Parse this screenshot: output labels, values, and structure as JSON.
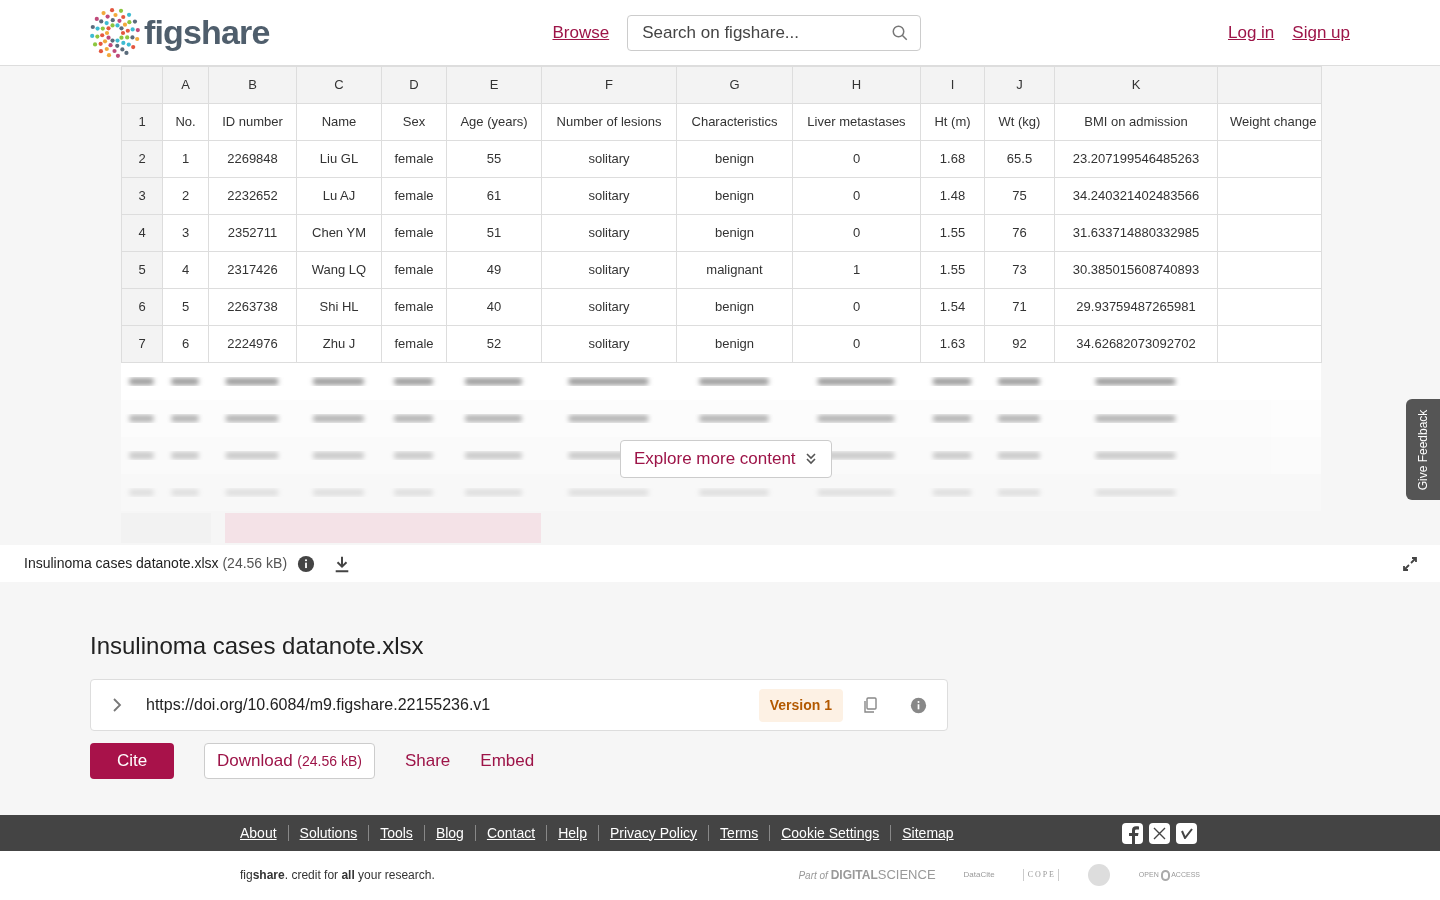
{
  "header": {
    "logo_text": "figshare",
    "nav": [
      {
        "label": "Browse"
      }
    ],
    "search": {
      "placeholder": "Search on figshare..."
    },
    "account": [
      {
        "label": "Log in"
      },
      {
        "label": "Sign up"
      }
    ]
  },
  "spreadsheet": {
    "column_letters": [
      "A",
      "B",
      "C",
      "D",
      "E",
      "F",
      "G",
      "H",
      "I",
      "J",
      "K"
    ],
    "rows": [
      {
        "number": "1",
        "cells": [
          "No.",
          "ID number",
          "Name",
          "Sex",
          "Age (years)",
          "Number of lesions",
          "Characteristics",
          "Liver metastases",
          "Ht (m)",
          "Wt (kg)",
          "BMI on admission",
          "Weight change"
        ]
      },
      {
        "number": "2",
        "cells": [
          "1",
          "2269848",
          "Liu GL",
          "female",
          "55",
          "solitary",
          "benign",
          "0",
          "1.68",
          "65.5",
          "23.207199546485263",
          ""
        ]
      },
      {
        "number": "3",
        "cells": [
          "2",
          "2232652",
          "Lu AJ",
          "female",
          "61",
          "solitary",
          "benign",
          "0",
          "1.48",
          "75",
          "34.240321402483566",
          ""
        ]
      },
      {
        "number": "4",
        "cells": [
          "3",
          "2352711",
          "Chen YM",
          "female",
          "51",
          "solitary",
          "benign",
          "0",
          "1.55",
          "76",
          "31.633714880332985",
          ""
        ]
      },
      {
        "number": "5",
        "cells": [
          "4",
          "2317426",
          "Wang LQ",
          "female",
          "49",
          "solitary",
          "malignant",
          "1",
          "1.55",
          "73",
          "30.385015608740893",
          ""
        ]
      },
      {
        "number": "6",
        "cells": [
          "5",
          "2263738",
          "Shi HL",
          "female",
          "40",
          "solitary",
          "benign",
          "0",
          "1.54",
          "71",
          "29.93759487265981",
          ""
        ]
      },
      {
        "number": "7",
        "cells": [
          "6",
          "2224976",
          "Zhu J",
          "female",
          "52",
          "solitary",
          "benign",
          "0",
          "1.63",
          "92",
          "34.62682073092702",
          ""
        ]
      }
    ],
    "explore_button": "Explore more content"
  },
  "feedback_tab": "Give Feedback",
  "file_bar": {
    "name": "Insulinoma cases datanote.xlsx",
    "size": "(24.56 kB)"
  },
  "item": {
    "title": "Insulinoma cases datanote.xlsx",
    "doi": "https://doi.org/10.6084/m9.figshare.22155236.v1",
    "version": "Version 1",
    "actions": [
      {
        "kind": "primary",
        "label": "Cite"
      },
      {
        "kind": "outlined",
        "label": "Download",
        "extra": "(24.56 kB)"
      },
      {
        "kind": "link",
        "label": "Share"
      },
      {
        "kind": "link",
        "label": "Embed"
      }
    ]
  },
  "footer": {
    "links": [
      "About",
      "Solutions",
      "Tools",
      "Blog",
      "Contact",
      "Help",
      "Privacy Policy",
      "Terms",
      "Cookie Settings",
      "Sitemap"
    ],
    "tagline": "fig**share**. credit for **all** your research.",
    "partners": [
      {
        "kind": "digital_science",
        "prefix": "Part of",
        "name": "DIGITAL",
        "suffix": "SCIENCE"
      },
      {
        "kind": "datacite",
        "name": "DataCite"
      },
      {
        "kind": "cope",
        "name": "C O P E"
      },
      {
        "kind": "seal"
      },
      {
        "kind": "open_access",
        "prefix": "OPEN",
        "suffix": "ACCESS"
      }
    ]
  }
}
